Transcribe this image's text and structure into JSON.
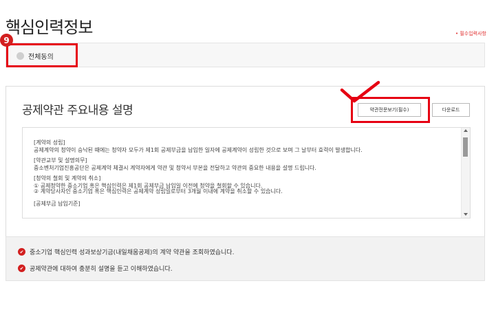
{
  "header": {
    "title": "핵심인력정보",
    "required_note": "• 필수입력사항"
  },
  "step_badge": "9",
  "all_agree": {
    "label": "전체동의"
  },
  "terms": {
    "title": "공제약관 주요내용 설명",
    "fullview_button": "약관전문보기(필수)",
    "download_button": "다운로드",
    "sections": [
      {
        "heading": "[계약의 성립]",
        "body": "공제계약의 청약이 승낙된 때에는 청약자 모두가 제1회 공제부금을 납입한 일자에 공제계약이 성립한 것으로 보며 그 날부터 효력이 발생합니다."
      },
      {
        "heading": "[약관교부 및 설명의무]",
        "body": "중소벤처기업진흥공단은 공제계약 체결시 계약자에게 약관 및 청약서 부본을 전달하고 약관의 중요한 내용을 설명 드립니다."
      },
      {
        "heading": "[청약의 철회 및 계약의 취소]",
        "body": "① 공제청약한 중소기업 혹은 핵심인력은 제1회 공제부금 납입일 이전에 청약을 철회할 수 있습니다.",
        "body2": "② 계약당사자인 중소기업 혹은 핵심인력은 공제계약 성립일로부터 3개월 이내에 계약을 취소할 수 있습니다."
      },
      {
        "heading": "[공제부금 납입기준]"
      }
    ]
  },
  "confirmations": [
    {
      "text": "중소기업 핵심인력 성과보상기금(내일채움공제)의 계약 약관을 조회하였습니다."
    },
    {
      "text": "공제약관에 대하여 충분히 설명을 듣고 이해하였습니다."
    }
  ],
  "colors": {
    "accent_red": "#e60012",
    "badge_red": "#d21f1f"
  }
}
